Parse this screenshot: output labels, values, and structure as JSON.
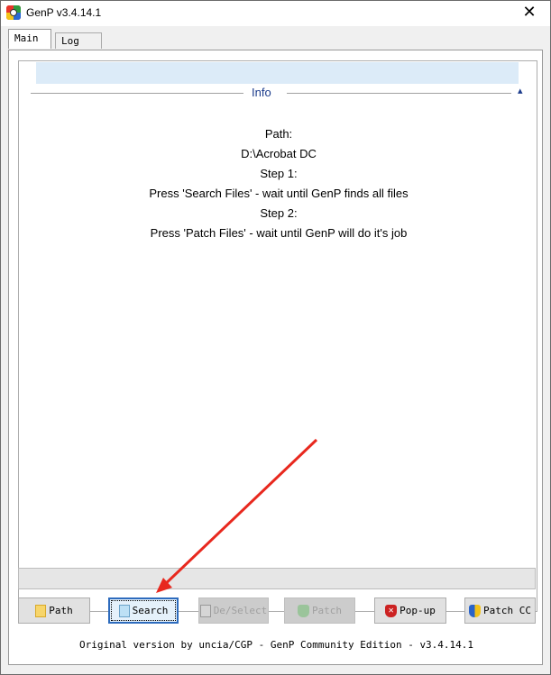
{
  "window": {
    "title": "GenP v3.4.14.1",
    "close_glyph": "✕"
  },
  "tabs": [
    {
      "label": "Main"
    },
    {
      "label": "Log"
    }
  ],
  "info": {
    "header": "Info",
    "collapse_glyph": "▴",
    "lines": [
      "Path:",
      "D:\\Acrobat DC",
      "Step 1:",
      "Press 'Search Files' - wait until GenP finds all files",
      "Step 2:",
      "Press 'Patch Files' - wait until GenP will do it's job"
    ]
  },
  "buttons": {
    "path": {
      "label": "Path",
      "icon": "folder-icon",
      "enabled": true
    },
    "search": {
      "label": "Search",
      "icon": "search-icon",
      "enabled": true
    },
    "deselect": {
      "label": "De/Select",
      "icon": "checkbox-icon",
      "enabled": false
    },
    "patch": {
      "label": "Patch",
      "icon": "green-shield-check-icon",
      "enabled": false
    },
    "popup": {
      "label": "Pop-up",
      "icon": "red-shield-x-icon",
      "enabled": true
    },
    "patch_cc": {
      "label": "Patch CC",
      "icon": "uac-shield-icon",
      "enabled": true
    }
  },
  "footer": {
    "text": "Original version by uncia/CGP - GenP Community Edition - v3.4.14.1"
  },
  "colors": {
    "accent": "#1c3c8c",
    "info_bar": "#dcebf8",
    "annotation_arrow": "#e8281e"
  }
}
